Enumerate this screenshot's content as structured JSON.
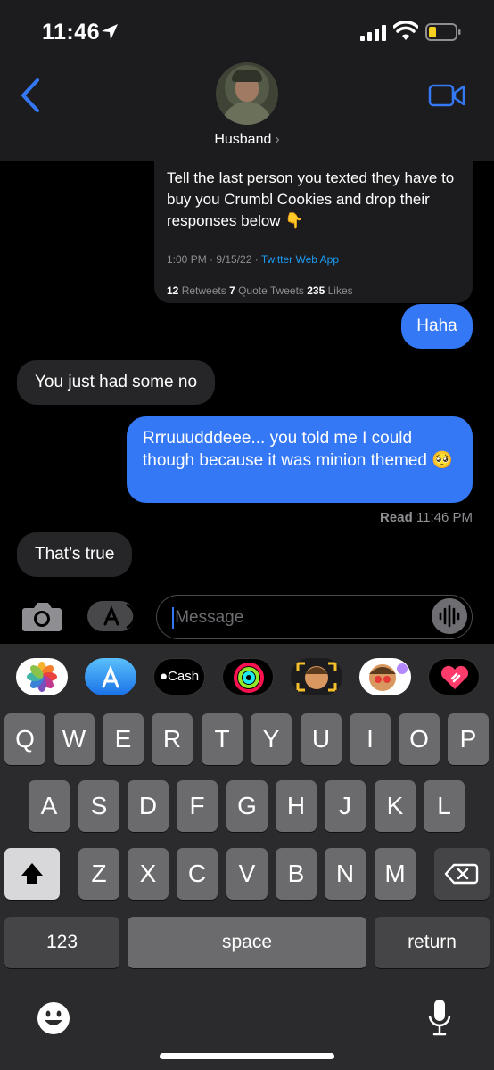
{
  "status_bar": {
    "time": "11:46",
    "battery_color": "#f5d020"
  },
  "header": {
    "contact_name": "Husband",
    "contact_chevron": "›",
    "accent": "#3478f6"
  },
  "conversation": {
    "tweet": {
      "text": "Tell the last person you texted they have to buy you Crumbl Cookies and drop their responses below 👇",
      "timestamp": "1:00 PM · 9/15/22 · ",
      "source": "Twitter Web App",
      "retweets": "12",
      "retweets_label": " Retweets ",
      "quotes": "7",
      "quotes_label": " Quote Tweets ",
      "likes": "235",
      "likes_label": " Likes"
    },
    "messages": [
      {
        "from": "me",
        "text": "Haha"
      },
      {
        "from": "them",
        "text": "You just had some no"
      },
      {
        "from": "me",
        "text": "Rrruuudddeee... you told me I could though because it was minion themed 🥺"
      },
      {
        "from": "them",
        "text": "That’s true"
      }
    ],
    "read_receipt": {
      "label": "Read",
      "time": " 11:46 PM"
    }
  },
  "input": {
    "placeholder": "iMessage",
    "value": ""
  },
  "app_strip": [
    {
      "name": "photos-app",
      "label": ""
    },
    {
      "name": "app-store-app",
      "label": ""
    },
    {
      "name": "apple-cash-app",
      "label": "Cash"
    },
    {
      "name": "activity-app",
      "label": ""
    },
    {
      "name": "memoji-app",
      "label": ""
    },
    {
      "name": "memoji-stickers-app",
      "label": ""
    },
    {
      "name": "digital-touch-app",
      "label": ""
    }
  ],
  "keyboard": {
    "row1": [
      "Q",
      "W",
      "E",
      "R",
      "T",
      "Y",
      "U",
      "I",
      "O",
      "P"
    ],
    "row2": [
      "A",
      "S",
      "D",
      "F",
      "G",
      "H",
      "J",
      "K",
      "L"
    ],
    "row3": [
      "Z",
      "X",
      "C",
      "V",
      "B",
      "N",
      "M"
    ],
    "numbers_label": "123",
    "space_label": "space",
    "return_label": "return"
  }
}
